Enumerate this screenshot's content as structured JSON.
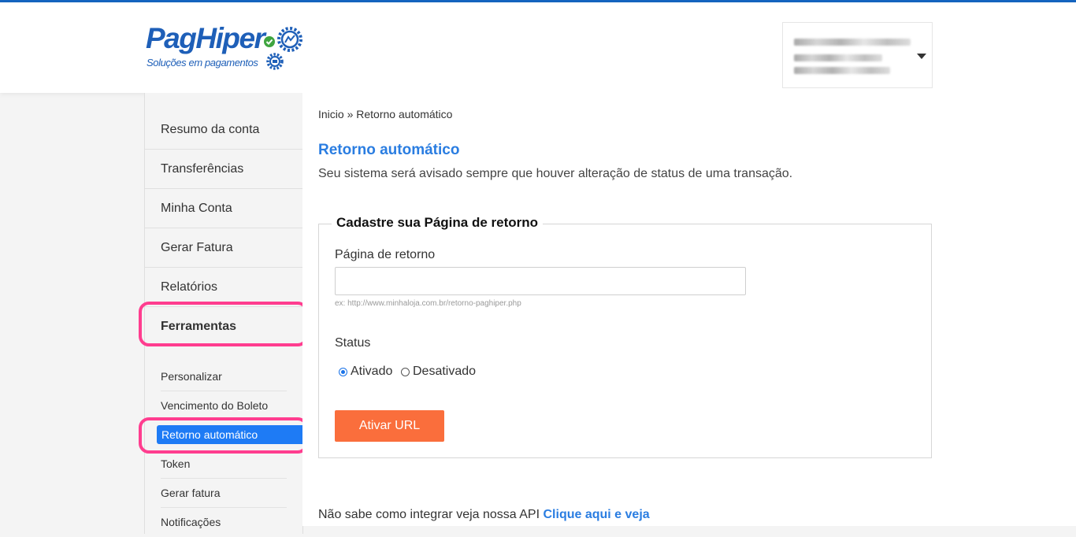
{
  "brand": {
    "name": "PagHiper",
    "tagline": "Soluções em pagamentos",
    "primary_color": "#1e5fb8",
    "accent_color": "#1e7bf5",
    "button_color": "#fa6e3c",
    "highlight_color": "#ff3d8f"
  },
  "user_menu": {
    "icon": "chevron-down-icon"
  },
  "sidebar": {
    "items": [
      {
        "label": "Resumo da conta"
      },
      {
        "label": "Transferências"
      },
      {
        "label": "Minha Conta"
      },
      {
        "label": "Gerar Fatura"
      },
      {
        "label": "Relatórios"
      },
      {
        "label": "Ferramentas"
      }
    ],
    "subitems": [
      {
        "label": "Personalizar"
      },
      {
        "label": "Vencimento do Boleto"
      },
      {
        "label": "Retorno automático",
        "active": true
      },
      {
        "label": "Token"
      },
      {
        "label": "Gerar fatura"
      },
      {
        "label": "Notificações"
      }
    ]
  },
  "main": {
    "breadcrumb": "Inicio » Retorno automático",
    "title": "Retorno automático",
    "description": "Seu sistema será avisado sempre que houver alteração de status de uma transação.",
    "form": {
      "legend": "Cadastre sua Página de retorno",
      "url_label": "Página de retorno",
      "url_value": "",
      "url_hint": "ex: http://www.minhaloja.com.br/retorno-paghiper.php",
      "status_label": "Status",
      "options": [
        "Ativado",
        "Desativado"
      ],
      "selected_option": "Ativado",
      "submit_label": "Ativar URL"
    },
    "api_text": "Não sabe como integrar veja nossa API",
    "api_link": "Clique aqui e veja"
  }
}
